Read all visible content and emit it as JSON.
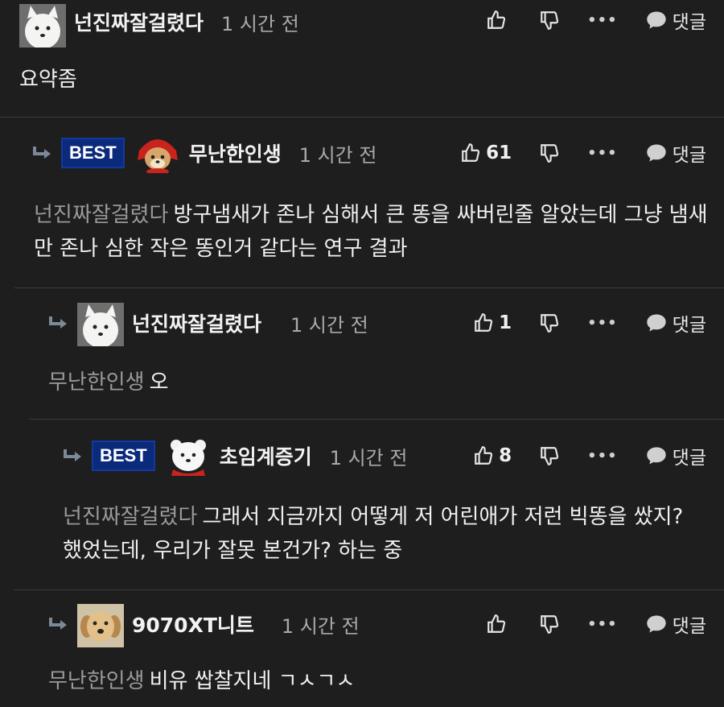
{
  "colors": {
    "background": "#1e1e1e",
    "best_badge": "#0b2a7c",
    "mention": "#9a9a9a"
  },
  "comments": [
    {
      "nickname": "넌진짜잘걸렸다",
      "time": "1 시간 전",
      "likes": "",
      "best": "",
      "reply_label": "댓글",
      "mention": "",
      "text": "요약좀",
      "avatar_icon": "white-dog-avatar"
    },
    {
      "nickname": "무난한인생",
      "time": "1 시간 전",
      "likes": "61",
      "best": "BEST",
      "reply_label": "댓글",
      "mention": "넌진짜잘걸렸다",
      "text": "방구냄새가 존나 심해서 큰 똥을 싸버린줄 알았는데 그냥 냄새만 존나 심한 작은 똥인거 같다는 연구 결과",
      "avatar_icon": "puppy-red-hood-avatar"
    },
    {
      "nickname": "넌진짜잘걸렸다",
      "time": "1 시간 전",
      "likes": "1",
      "best": "",
      "reply_label": "댓글",
      "mention": "무난한인생",
      "text": "오",
      "avatar_icon": "white-dog-avatar"
    },
    {
      "nickname": "초임계증기",
      "time": "1 시간 전",
      "likes": "8",
      "best": "BEST",
      "reply_label": "댓글",
      "mention": "넌진짜잘걸렸다",
      "text": "그래서 지금까지 어떻게 저 어린애가 저런 빅똥을 쌌지? 했었는데, 우리가 잘못 본건가? 하는 중",
      "avatar_icon": "polar-bear-avatar"
    },
    {
      "nickname": "9070XT니트",
      "time": "1 시간 전",
      "likes": "",
      "best": "",
      "reply_label": "댓글",
      "mention": "무난한인생",
      "text": "비유 쌉찰지네 ㄱㅅㄱㅅ",
      "avatar_icon": "retriever-puppy-avatar"
    }
  ],
  "more_label": "•••"
}
